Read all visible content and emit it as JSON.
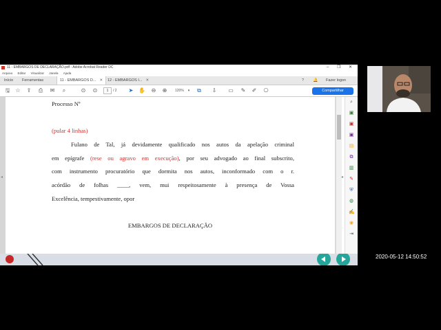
{
  "window": {
    "title": "11 - EMBARGOS DE DECLARAÇÃO.pdf - Adobe Acrobat Reader DC",
    "controls": [
      "–",
      "❐",
      "✕"
    ]
  },
  "menubar": {
    "items": [
      "Arquivo",
      "Editar",
      "Visualizar",
      "Janela",
      "Ajuda"
    ]
  },
  "tabs": {
    "home": "Início",
    "tools": "Ferramentas",
    "doc1": "11 - EMBARGOS D...",
    "doc2": "12 - EMBARGOS I...",
    "help_icon": "?",
    "notif_icon": "🔔",
    "login": "Fazer logon"
  },
  "toolbar": {
    "page_current": "1",
    "page_sep": "/ 2",
    "zoom": "120%",
    "share": "Compartilhar"
  },
  "document": {
    "line1": "Processo Nº",
    "line2": "(pular 4 linhas)",
    "line3": "Fulano de Tal, já devidamente qualificado nos autos da apelação criminal",
    "line4a": "em epígrafe ",
    "line4b": "(rese ou agravo em execução)",
    "line4c": ", por seu advogado ao final subscrito,",
    "line5": "com instrumento procuratório que dormita nos autos, inconformado com o r.",
    "line6": "acórdão de folhas ____, vem, mui respeitosamente à presença de Vossa",
    "line7": "Excelência, tempestivamente, opor",
    "heading": "EMBARGOS DE DECLARAÇÃO"
  },
  "timestamp": "2020-05-12 14:50:52",
  "colors": {
    "accent": "#1a73e8",
    "red_text": "#d32f2f"
  }
}
